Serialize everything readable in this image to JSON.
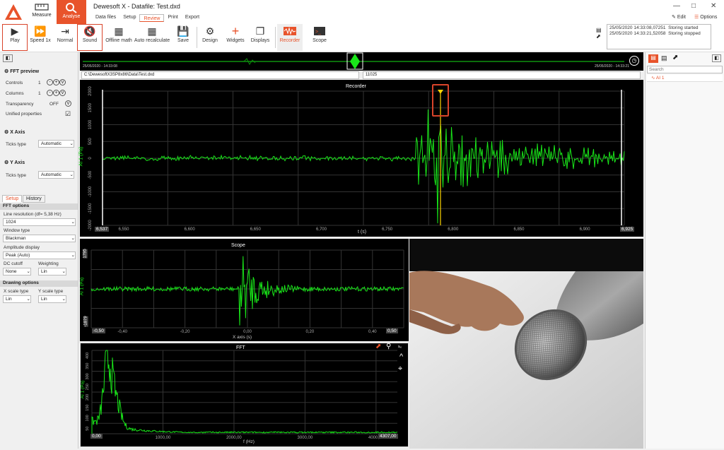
{
  "app": {
    "title": "Dewesoft X - Datafile: Test.dxd"
  },
  "nav": {
    "measure": "Measure",
    "analyse": "Analyse"
  },
  "tabs": [
    "Data files",
    "Setup",
    "Review",
    "Print",
    "Export"
  ],
  "top_right": {
    "edit": "Edit",
    "options": "Options"
  },
  "toolbar": {
    "play": "Play",
    "speed": "Speed 1x",
    "normal": "Normal",
    "sound": "Sound",
    "offline_math": "Offline math",
    "auto_recalc": "Auto recalculate",
    "save": "Save",
    "design": "Design",
    "widgets": "Widgets",
    "displays": "Displays",
    "recorder": "Recorder",
    "scope": "Scope"
  },
  "log": [
    {
      "time": "25/05/2020 14:33:08,07251",
      "msg": "Storing started"
    },
    {
      "time": "25/05/2020 14:33:21,52058",
      "msg": "Storing stopped"
    }
  ],
  "overview": {
    "start": "25/05/2020 - 14:33:08",
    "end": "25/05/2020 - 14:33:21",
    "path": "C:\\DewesoftX3SP8x86\\Data\\Test.dxd",
    "samples": "11025"
  },
  "left": {
    "fft_preview": "FFT preview",
    "controls_label": "Controls",
    "controls_value": "1",
    "columns_label": "Columns",
    "columns_value": "1",
    "transparency_label": "Transparency",
    "transparency_value": "OFF",
    "unified_label": "Unified properties",
    "x_axis": "X Axis",
    "y_axis": "Y Axis",
    "ticks_label": "Ticks type",
    "ticks_value": "Automatic",
    "setup_tab": "Setup",
    "history_tab": "History",
    "fft_options": "FFT options",
    "line_res_label": "Line resolution (df= 5,38 Hz)",
    "line_res_value": "1024",
    "window_label": "Window type",
    "window_value": "Blackman",
    "amp_label": "Amplitude display",
    "amp_value": "Peak (Auto)",
    "dc_label": "DC cutoff",
    "dc_value": "None",
    "weight_label": "Weighting",
    "weight_value": "Lin",
    "drawing_options": "Drawing options",
    "xscale_label": "X scale type",
    "xscale_value": "Lin",
    "yscale_label": "Y scale type",
    "yscale_value": "Lin"
  },
  "recorder": {
    "title": "Recorder",
    "ylabel": "AI 1 (Pa)",
    "xlabel": "t (s)",
    "xmin": "6,537",
    "xmax": "6,925",
    "xticks": [
      "6,550",
      "6,600",
      "6,650",
      "6,700",
      "6,750",
      "6,800",
      "6,850",
      "6,900"
    ],
    "yticks": [
      "2000",
      "1500",
      "1000",
      "500",
      "0",
      "-500",
      "-1000",
      "-1500",
      "-2000"
    ]
  },
  "scope": {
    "title": "Scope",
    "ylabel": "AI 1 (Pa)",
    "xlabel": "X axis (s)",
    "xmin": "-0,50",
    "xmax": "0,50",
    "xticks": [
      "-0,40",
      "-0,20",
      "0,00",
      "0,20",
      "0,40"
    ],
    "ytop": "1795",
    "ybot": "-1879"
  },
  "fft": {
    "title": "FFT",
    "ylabel": "AI 1 (Pa)",
    "xlabel": "f (Hz)",
    "xmin": "0,00",
    "xmax": "4307,00",
    "xticks": [
      "1000,00",
      "2000,00",
      "3000,00",
      "4000,00"
    ],
    "yticks": [
      "400",
      "350",
      "300",
      "250",
      "200",
      "150",
      "100",
      "50"
    ]
  },
  "right": {
    "search_placeholder": "Search",
    "channel": "AI 1"
  },
  "colors": {
    "accent": "#e8532b",
    "signal": "#19e619",
    "highlight": "#d9442a"
  }
}
